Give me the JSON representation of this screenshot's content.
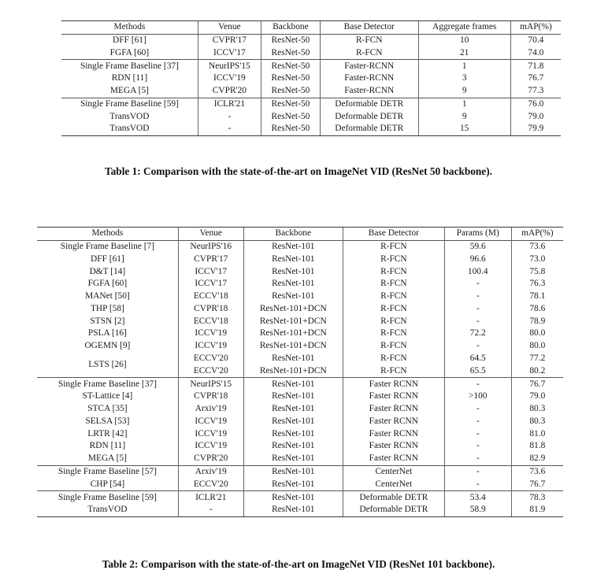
{
  "table1": {
    "caption": "Table 1: Comparison with the state-of-the-art on ImageNet VID (ResNet 50 backbone).",
    "columns": [
      "Methods",
      "Venue",
      "Backbone",
      "Base Detector",
      "Aggregate frames",
      "mAP(%)"
    ],
    "groups": [
      {
        "rows": [
          {
            "method": "DFF [61]",
            "venue": "CVPR'17",
            "backbone": "ResNet-50",
            "detector": "R-FCN",
            "frames": "10",
            "map": "70.4",
            "map_bold": false
          },
          {
            "method": "FGFA [60]",
            "venue": "ICCV'17",
            "backbone": "ResNet-50",
            "detector": "R-FCN",
            "frames": "21",
            "map": "74.0",
            "map_bold": false
          }
        ]
      },
      {
        "rows": [
          {
            "method": "Single Frame Baseline [37]",
            "venue": "NeurIPS'15",
            "backbone": "ResNet-50",
            "detector": "Faster-RCNN",
            "frames": "1",
            "map": "71.8",
            "map_bold": false
          },
          {
            "method": "RDN [11]",
            "venue": "ICCV'19",
            "backbone": "ResNet-50",
            "detector": "Faster-RCNN",
            "frames": "3",
            "map": "76.7",
            "map_bold": false
          },
          {
            "method": "MEGA [5]",
            "venue": "CVPR'20",
            "backbone": "ResNet-50",
            "detector": "Faster-RCNN",
            "frames": "9",
            "map": "77.3",
            "map_bold": false
          }
        ]
      },
      {
        "rows": [
          {
            "method": "Single Frame Baseline [59]",
            "venue": "ICLR'21",
            "backbone": "ResNet-50",
            "detector": "Deformable DETR",
            "frames": "1",
            "map": "76.0",
            "map_bold": false
          },
          {
            "method": "TransVOD",
            "venue": "-",
            "backbone": "ResNet-50",
            "detector": "Deformable DETR",
            "frames": "9",
            "map": "79.0",
            "map_bold": false
          },
          {
            "method": "TransVOD",
            "venue": "-",
            "backbone": "ResNet-50",
            "detector": "Deformable DETR",
            "frames": "15",
            "map": "79.9",
            "map_bold": true
          }
        ]
      }
    ]
  },
  "table2": {
    "caption": "Table 2: Comparison with the state-of-the-art on ImageNet VID (ResNet 101 backbone).",
    "columns": [
      "Methods",
      "Venue",
      "Backbone",
      "Base Detector",
      "Params (M)",
      "mAP(%)"
    ],
    "groups": [
      {
        "rows": [
          {
            "method": "Single Frame Baseline [7]",
            "venue": "NeurIPS'16",
            "backbone": "ResNet-101",
            "detector": "R-FCN",
            "params": "59.6",
            "map": "73.6",
            "map_bold": false
          },
          {
            "method": "DFF [61]",
            "venue": "CVPR'17",
            "backbone": "ResNet-101",
            "detector": "R-FCN",
            "params": "96.6",
            "map": "73.0",
            "map_bold": false
          },
          {
            "method": "D&T [14]",
            "venue": "ICCV'17",
            "backbone": "ResNet-101",
            "detector": "R-FCN",
            "params": "100.4",
            "map": "75.8",
            "map_bold": false
          },
          {
            "method": "FGFA [60]",
            "venue": "ICCV'17",
            "backbone": "ResNet-101",
            "detector": "R-FCN",
            "params": "-",
            "map": "76.3",
            "map_bold": false
          },
          {
            "method": "MANet [50]",
            "venue": "ECCV'18",
            "backbone": "ResNet-101",
            "detector": "R-FCN",
            "params": "-",
            "map": "78.1",
            "map_bold": false
          },
          {
            "method": "THP [58]",
            "venue": "CVPR'18",
            "backbone": "ResNet-101+DCN",
            "detector": "R-FCN",
            "params": "-",
            "map": "78.6",
            "map_bold": false
          },
          {
            "method": "STSN [2]",
            "venue": "ECCV'18",
            "backbone": "ResNet-101+DCN",
            "detector": "R-FCN",
            "params": "-",
            "map": "78.9",
            "map_bold": false
          },
          {
            "method": "PSLA [16]",
            "venue": "ICCV'19",
            "backbone": "ResNet-101+DCN",
            "detector": "R-FCN",
            "params": "72.2",
            "map": "80.0",
            "map_bold": false
          },
          {
            "method": "OGEMN [9]",
            "venue": "ICCV'19",
            "backbone": "ResNet-101+DCN",
            "detector": "R-FCN",
            "params": "-",
            "map": "80.0",
            "map_bold": false
          },
          {
            "method": "LSTS [26]",
            "method_rowspan": 2,
            "venue": "ECCV'20",
            "backbone": "ResNet-101",
            "detector": "R-FCN",
            "params": "64.5",
            "map": "77.2",
            "map_bold": false
          },
          {
            "method": null,
            "venue": "ECCV'20",
            "backbone": "ResNet-101+DCN",
            "detector": "R-FCN",
            "params": "65.5",
            "map": "80.2",
            "map_bold": false
          }
        ]
      },
      {
        "rows": [
          {
            "method": "Single Frame Baseline [37]",
            "venue": "NeurIPS'15",
            "backbone": "ResNet-101",
            "detector": "Faster RCNN",
            "params": "-",
            "map": "76.7",
            "map_bold": false
          },
          {
            "method": "ST-Lattice [4]",
            "venue": "CVPR'18",
            "backbone": "ResNet-101",
            "detector": "Faster RCNN",
            "params": ">100",
            "map": "79.0",
            "map_bold": false
          },
          {
            "method": "STCA [35]",
            "venue": "Arxiv'19",
            "backbone": "ResNet-101",
            "detector": "Faster RCNN",
            "params": "-",
            "map": "80.3",
            "map_bold": false
          },
          {
            "method": "SELSA [53]",
            "venue": "ICCV'19",
            "backbone": "ResNet-101",
            "detector": "Faster RCNN",
            "params": "-",
            "map": "80.3",
            "map_bold": false
          },
          {
            "method": "LRTR [42]",
            "venue": "ICCV'19",
            "backbone": "ResNet-101",
            "detector": "Faster RCNN",
            "params": "-",
            "map": "81.0",
            "map_bold": false
          },
          {
            "method": "RDN [11]",
            "venue": "ICCV'19",
            "backbone": "ResNet-101",
            "detector": "Faster RCNN",
            "params": "-",
            "map": "81.8",
            "map_bold": false
          },
          {
            "method": "MEGA [5]",
            "venue": "CVPR'20",
            "backbone": "ResNet-101",
            "detector": "Faster RCNN",
            "params": "-",
            "map": "82.9",
            "map_bold": true
          }
        ]
      },
      {
        "rows": [
          {
            "method": "Single Frame Baseline [57]",
            "venue": "Arxiv'19",
            "backbone": "ResNet-101",
            "detector": "CenterNet",
            "params": "-",
            "map": "73.6",
            "map_bold": false
          },
          {
            "method": "CHP [54]",
            "venue": "ECCV'20",
            "backbone": "ResNet-101",
            "detector": "CenterNet",
            "params": "-",
            "map": "76.7",
            "map_bold": false
          }
        ]
      },
      {
        "rows": [
          {
            "method": "Single Frame Baseline [59]",
            "venue": "ICLR'21",
            "backbone": "ResNet-101",
            "detector": "Deformable DETR",
            "params": "53.4",
            "map": "78.3",
            "map_bold": false
          },
          {
            "method": "TransVOD",
            "venue": "-",
            "backbone": "ResNet-101",
            "detector": "Deformable DETR",
            "params": "58.9",
            "map": "81.9",
            "map_bold": true
          }
        ]
      }
    ]
  }
}
